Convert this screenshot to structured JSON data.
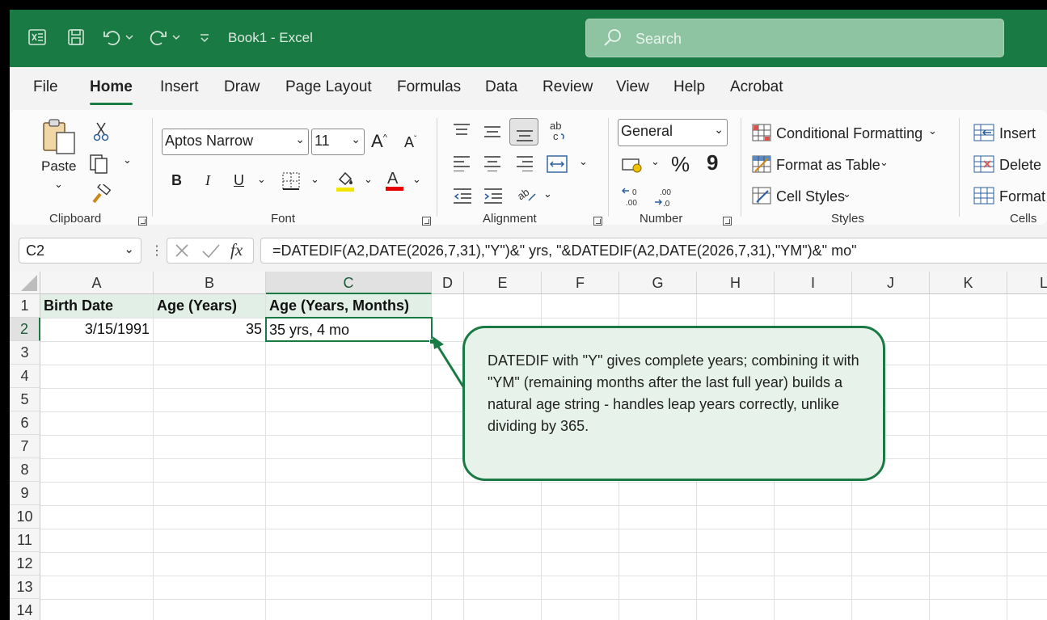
{
  "titlebar": {
    "doc_title": "Book1  -  Excel",
    "search_placeholder": "Search"
  },
  "menu": [
    "File",
    "Home",
    "Insert",
    "Draw",
    "Page Layout",
    "Formulas",
    "Data",
    "Review",
    "View",
    "Help",
    "Acrobat"
  ],
  "ribbon": {
    "clipboard": {
      "paste_label": "Paste",
      "group_label": "Clipboard"
    },
    "font": {
      "font_name": "Aptos Narrow",
      "font_size": "11",
      "group_label": "Font",
      "bold": "B",
      "italic": "I",
      "underline": "U"
    },
    "alignment": {
      "group_label": "Alignment"
    },
    "number": {
      "format": "General",
      "percent": "%",
      "comma": "9",
      "group_label": "Number"
    },
    "styles": {
      "conditional": "Conditional Formatting",
      "format_table": "Format as Table",
      "cell_styles": "Cell Styles",
      "group_label": "Styles"
    },
    "cells": {
      "insert": "Insert",
      "delete": "Delete",
      "format": "Format",
      "group_label": "Cells"
    }
  },
  "formula_bar": {
    "name_box": "C2",
    "fx": "fx",
    "formula": "=DATEDIF(A2,DATE(2026,7,31),\"Y\")&\" yrs, \"&DATEDIF(A2,DATE(2026,7,31),\"YM\")&\" mo\""
  },
  "grid": {
    "columns": [
      "A",
      "B",
      "C",
      "D",
      "E",
      "F",
      "G",
      "H",
      "I",
      "J",
      "K",
      "L"
    ],
    "rows": [
      "1",
      "2",
      "3",
      "4",
      "5",
      "6",
      "7",
      "8",
      "9",
      "10",
      "11",
      "12",
      "13",
      "14"
    ],
    "headers": {
      "a1": "Birth Date",
      "b1": "Age (Years)",
      "c1": "Age (Years, Months)"
    },
    "values": {
      "a2": "3/15/1991",
      "b2": "35",
      "c2": "35 yrs, 4 mo"
    }
  },
  "callout": {
    "text": "DATEDIF with \"Y\" gives complete years; combining it with \"YM\" (remaining months after the last full year) builds a natural age string - handles leap years correctly, unlike dividing by 365."
  },
  "colors": {
    "accent": "#1a7a43",
    "header_fill": "#e2efe6",
    "callout_fill": "#e6f2ea"
  }
}
